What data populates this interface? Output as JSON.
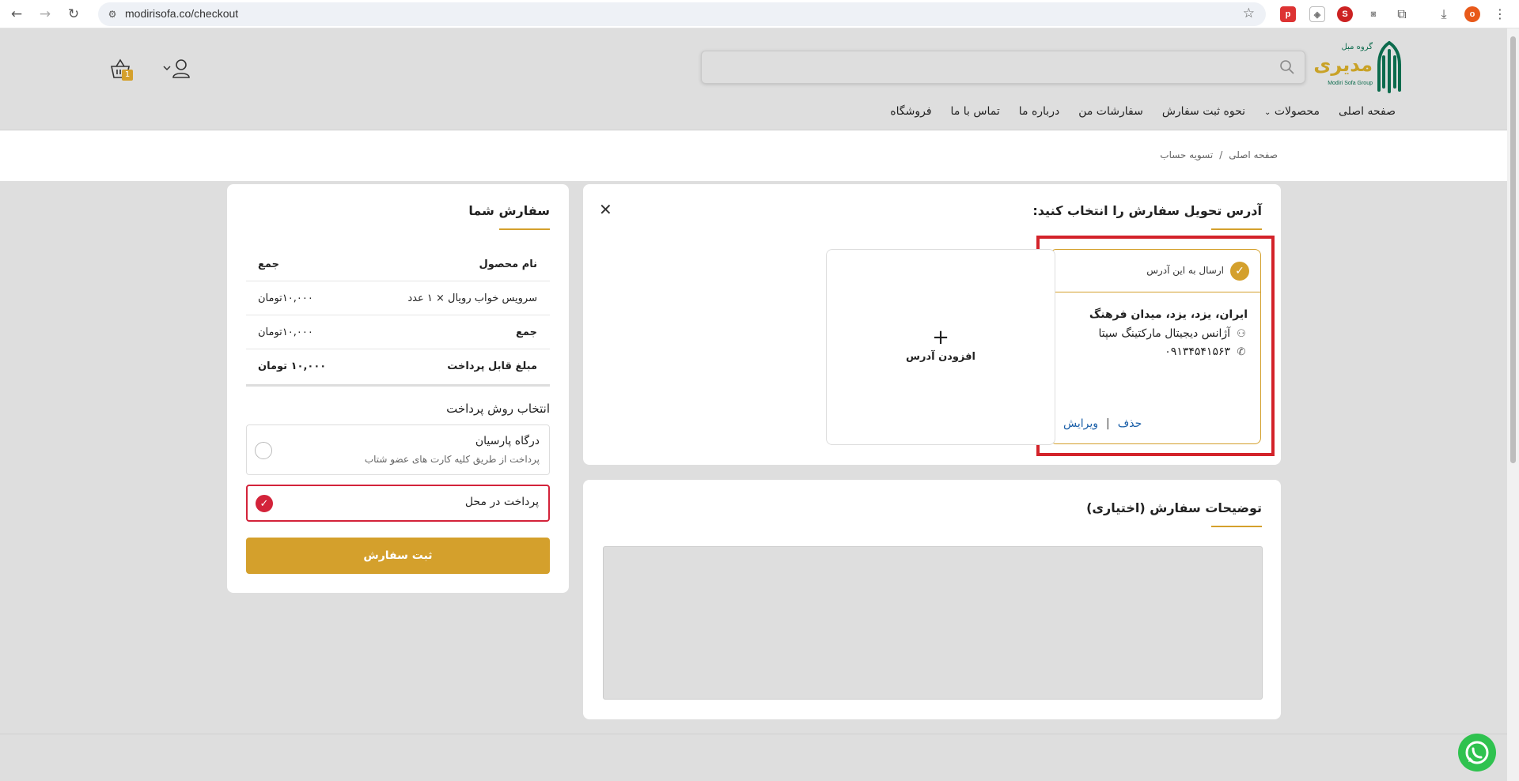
{
  "browser": {
    "url": "modirisofa.co/checkout"
  },
  "header": {
    "logo_text": "مدیری",
    "logo_top": "گروه مبل",
    "logo_en": "Modiri Sofa Group",
    "search_placeholder": "",
    "cart_count": "1",
    "nav": [
      "صفحه اصلی",
      "محصولات",
      "نحوه ثبت سفارش",
      "سفارشات من",
      "درباره ما",
      "تماس با ما",
      "فروشگاه"
    ]
  },
  "breadcrumb": {
    "home": "صفحه اصلی",
    "separator": "/",
    "current": "تسویه حساب"
  },
  "address_section": {
    "title": "آدرس تحویل سفارش را انتخاب کنید:",
    "send_label": "ارسال به این آدرس",
    "address": "ایران، یزد، یزد، میدان فرهنگ",
    "recipient": "آژانس دیجیتال مارکتینگ سپتا",
    "phone": "۰۹۱۳۴۵۴۱۵۶۳",
    "delete_label": "حذف",
    "edit_label": "ویرایش",
    "action_separator": "|",
    "add_plus": "+",
    "add_label": "افزودن آدرس"
  },
  "notes_section": {
    "title": "توضیحات سفارش (اختیاری)"
  },
  "order": {
    "title": "سفارش شما",
    "header_product": "نام محصول",
    "header_total": "جمع",
    "item_name": "سرویس خواب رویال × ۱ عدد",
    "item_price": "۱۰,۰۰۰تومان",
    "subtotal_label": "جمع",
    "subtotal_value": "۱۰,۰۰۰تومان",
    "payable_label": "مبلغ قابل پرداخت",
    "payable_value": "۱۰,۰۰۰ تومان",
    "payment_title": "انتخاب روش پرداخت",
    "gateway_name": "درگاه پارسیان",
    "gateway_desc": "پرداخت از طریق کلیه کارت های عضو شتاب",
    "cod_name": "پرداخت در محل",
    "submit_label": "ثبت سفارش"
  },
  "colors": {
    "accent": "#d4a02c",
    "highlight": "#d3232a",
    "selected_radio": "#d3233a",
    "link": "#1a5fa8"
  }
}
